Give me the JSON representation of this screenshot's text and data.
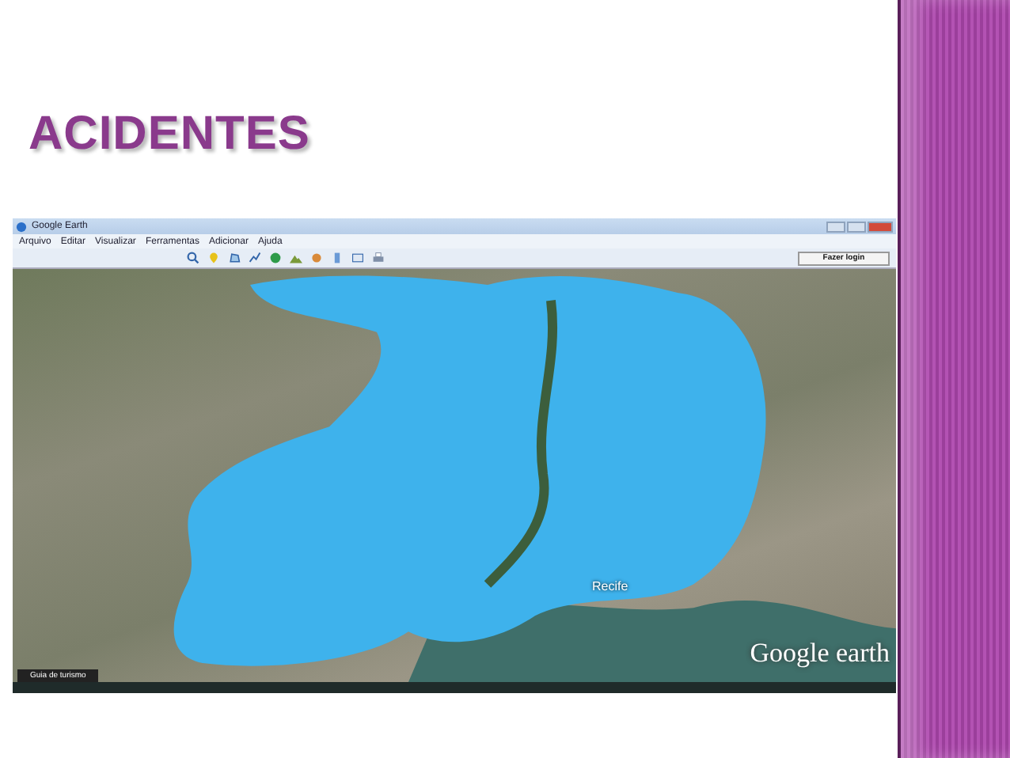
{
  "slide": {
    "title": "ACIDENTES"
  },
  "window": {
    "title": "Google Earth",
    "menu": [
      "Arquivo",
      "Editar",
      "Visualizar",
      "Ferramentas",
      "Adicionar",
      "Ajuda"
    ],
    "login_button": "Fazer login"
  },
  "map": {
    "place_label": "Recife",
    "logo": "Google earth",
    "tab": "Guia de turismo"
  }
}
